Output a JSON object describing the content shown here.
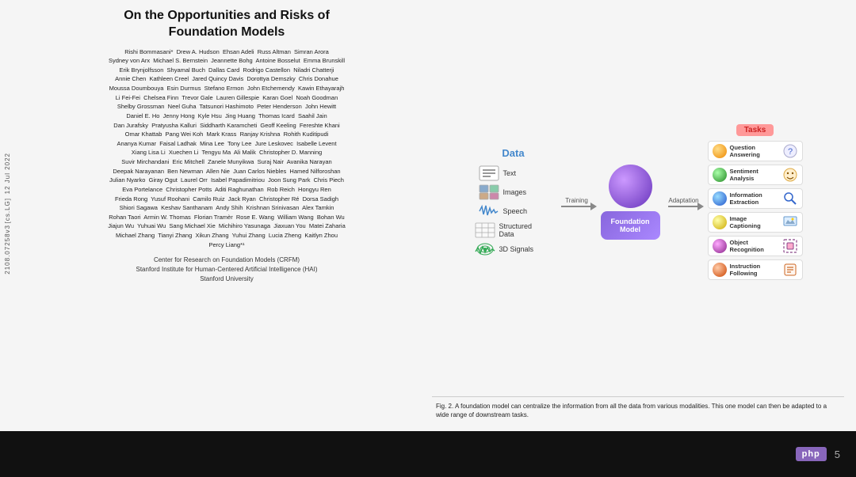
{
  "slide": {
    "paper_title_line1": "On the Opportunities and Risks of",
    "paper_title_line2": "Foundation Models",
    "authors_text": "Rishi Bommasani*  Drew A. Hudson  Ehsan Adeli  Russ Altman  Simran Arora\nSydney von Arx  Michael S. Bernstein  Jeannette Bohg  Antoine Bosselut  Emma Brunskill\nErik Brynjolfsson  Shyamal Buch  Dallas Card  Rodrigo Castellon  Niladri Chatterji\nAnnie Chen  Kathleen Creel  Jared Quincy Davis  Dorottya Demszky  Chris Donahue\nMoussa Doumbouya  Esin Durmus  Stefano Ermon  John Etchemendy  Kawin Ethayarajh\nLi Fei-Fei  Chelsea Finn  Trevor Gale  Lauren Gillespie  Karan Goel  Noah Goodman\nShelby Grossman  Neel Guha  Tatsunori Hashimoto  Peter Henderson  John Hewitt\nDaniel E. Ho  Jenny Hong  Kyle Hsu  Jing Huang  Thomas Icard  Saahil Jain\nDan Jurafsky  Pratyusha Kalluri  Siddharth Karamcheti  Geoff Keeling  Fereshte Khani\nOmar Khattab  Pang Wei Koh  Mark Krass  Ranjay Krishna  Rohith Kuditipudi\nAnanya Kumar  Faisal Ladhak  Mina Lee  Tony Lee  Jure Leskovec  Isabelle Levent\nXiang Lisa Li  Xuechen Li  Tengyu Ma  Ali Malik  Christopher D. Manning\nSuvir Mirchandani  Eric Mitchell  Zanele Munyikwa  Suraj Nair  Avanika Narayan\nDeepal Narayanan  Ben Newman  Allen Nie  Juan Carlos Niebles  Hamed Nilforoshan\nJulian Nyarko  Giray Ogut  Laurel Orr  Isabel Papadimitriou  Joon Sung Park  Chris Piech\nEva Portelance  Christopher Potts  Aditi Raghunathan  Rob Reich  Hongyu Ren\nFrieda Rong  Yusuf Roohani  Camilo Ruiz  Jack Ryan  Christopher Ré  Dorsa Sadigh\nShiori Sagawa  Keshav Santhanam  Andy Shih  Krishnan Srinivasan  Alex Tamkin\nRohan Taori  Armin W. Thomas  Florian Tramèr  Rose E. Wang  William Wang  Bohan Wu\nJiajun Wu  Yuhuai Wu  Sang Michael Xie  Michihiro Yasunaga  Jiaxuan You  Matei Zaharia\nMichael Zhang  Tianyi Zhang  Xikun Zhang  Yuhui Zhang  Lucia Zheng  Kaitlyn Zhou\nPercy Liang*¹",
    "affiliation1": "Center for Research on Foundation Models (CRFM)",
    "affiliation2": "Stanford Institute for Human-Centered Artificial Intelligence (HAI)",
    "affiliation3": "Stanford University",
    "date_label": "12 Jul 2022",
    "arxiv_label": "[cs.LG]",
    "arxiv_id": "2108.07258v3",
    "diagram": {
      "data_title": "Data",
      "data_items": [
        {
          "label": "Text",
          "icon": "text"
        },
        {
          "label": "Images",
          "icon": "images"
        },
        {
          "label": "Speech",
          "icon": "speech"
        },
        {
          "label": "Structured Data",
          "icon": "structured"
        },
        {
          "label": "3D Signals",
          "icon": "signals"
        }
      ],
      "training_label": "Training",
      "foundation_label": "Foundation\nModel",
      "adaptation_label": "Adaptation",
      "tasks_title": "Tasks",
      "task_items": [
        {
          "label": "Question\nAnswering",
          "color": "#ffaa33"
        },
        {
          "label": "Sentiment\nAnalysis",
          "color": "#66cc44"
        },
        {
          "label": "Information\nExtraction",
          "color": "#3399ff"
        },
        {
          "label": "Image\nCaptioning",
          "color": "#ffcc22"
        },
        {
          "label": "Object\nRecognition",
          "color": "#cc44bb"
        },
        {
          "label": "Instruction\nFollowing",
          "color": "#ff6644"
        }
      ]
    },
    "caption": "Fig. 2.  A foundation model can centralize the information from all the data from various modalities. This one model can then be adapted to a wide range of downstream tasks.",
    "slide_number": "5",
    "php_badge": "php"
  }
}
